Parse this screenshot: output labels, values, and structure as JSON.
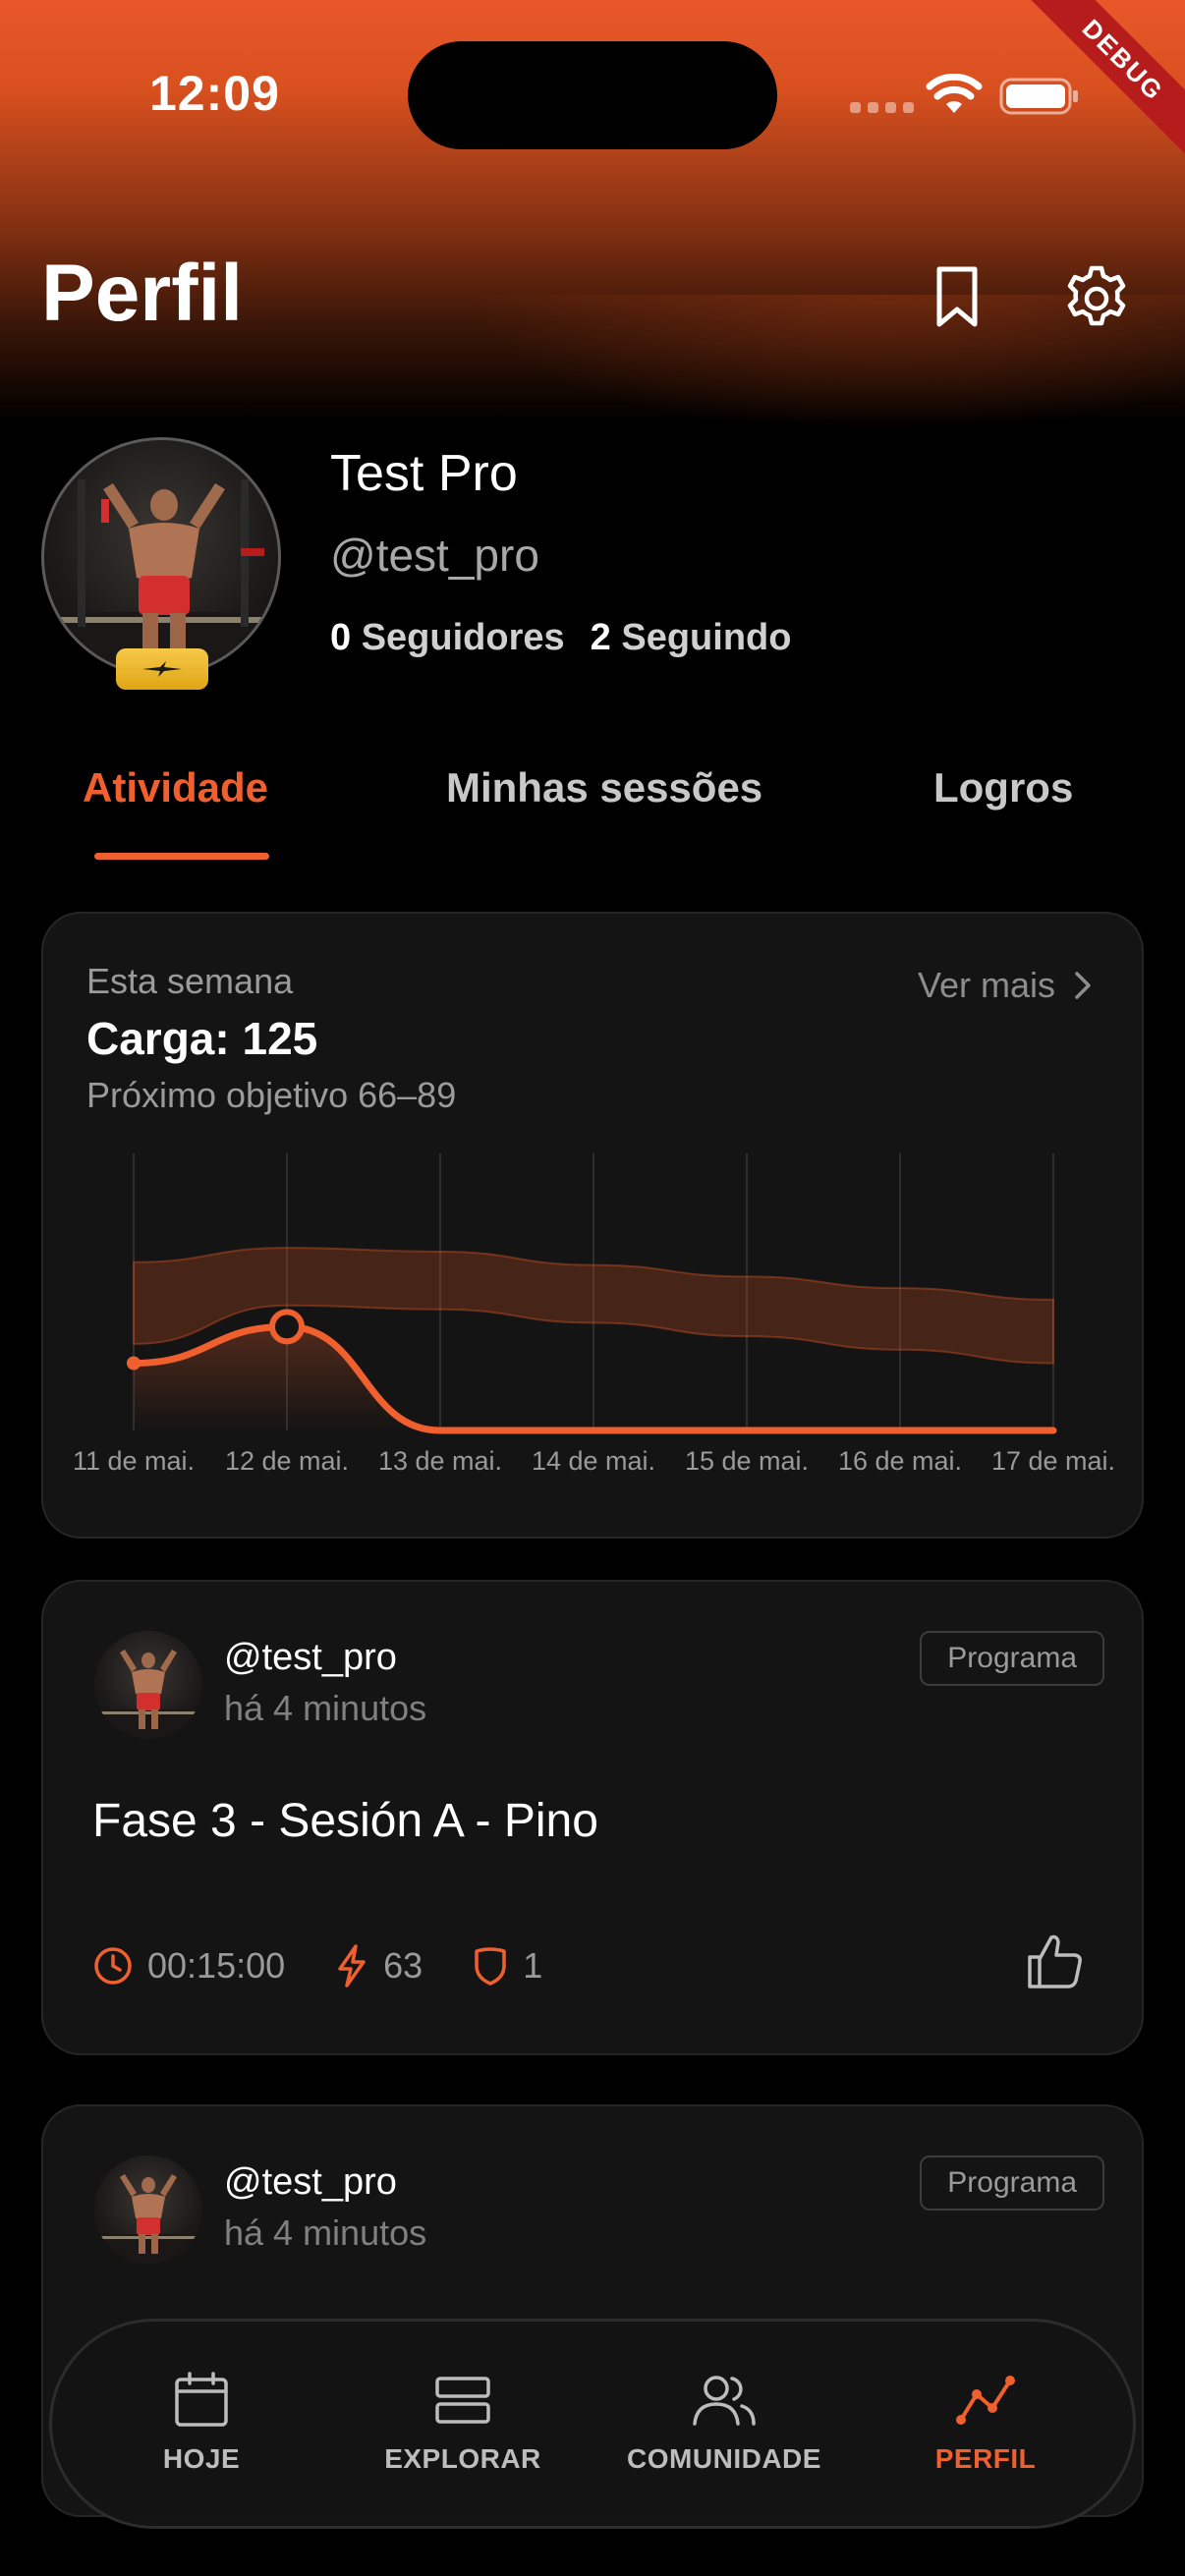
{
  "status_bar": {
    "time": "12:09",
    "debug_label": "DEBUG"
  },
  "header": {
    "title": "Perfil"
  },
  "profile": {
    "name": "Test Pro",
    "handle": "@test_pro",
    "followers_count": "0",
    "followers_label": "Seguidores",
    "following_count": "2",
    "following_label": "Seguindo"
  },
  "tabs": [
    {
      "label": "Atividade",
      "active": true
    },
    {
      "label": "Minhas sessões",
      "active": false
    },
    {
      "label": "Logros",
      "active": false
    }
  ],
  "weekly": {
    "kicker": "Esta semana",
    "value": "Carga: 125",
    "goal": "Próximo objetivo 66–89",
    "see_more": "Ver mais"
  },
  "chart_data": {
    "type": "line",
    "categories": [
      "11 de mai.",
      "12 de mai.",
      "13 de mai.",
      "14 de mai.",
      "15 de mai.",
      "16 de mai.",
      "17 de mai."
    ],
    "series": [
      {
        "values": [
          70,
          108,
          0,
          0,
          0,
          0,
          0
        ]
      }
    ],
    "band": {
      "lower": [
        90,
        130,
        126,
        112,
        98,
        84,
        70
      ],
      "upper": [
        175,
        190,
        186,
        172,
        160,
        148,
        136
      ]
    },
    "ylim": [
      0,
      280
    ],
    "highlight_index": 1,
    "accent_color": "#f0602e",
    "grid": "vertical"
  },
  "posts": [
    {
      "user": "@test_pro",
      "time": "há 4 minutos",
      "chip": "Programa",
      "title": "Fase 3 - Sesión A - Pino",
      "duration": "00:15:00",
      "load": "63",
      "count": "1"
    },
    {
      "user": "@test_pro",
      "time": "há 4 minutos",
      "chip": "Programa"
    }
  ],
  "nav": [
    {
      "label": "HOJE",
      "icon": "calendar-icon",
      "active": false
    },
    {
      "label": "EXPLORAR",
      "icon": "explore-icon",
      "active": false
    },
    {
      "label": "COMUNIDADE",
      "icon": "community-icon",
      "active": false
    },
    {
      "label": "PERFIL",
      "icon": "activity-chart-icon",
      "active": true
    }
  ],
  "colors": {
    "accent": "#f0602e",
    "background": "#000000",
    "card": "#141414",
    "badge": "#f1b72c"
  }
}
